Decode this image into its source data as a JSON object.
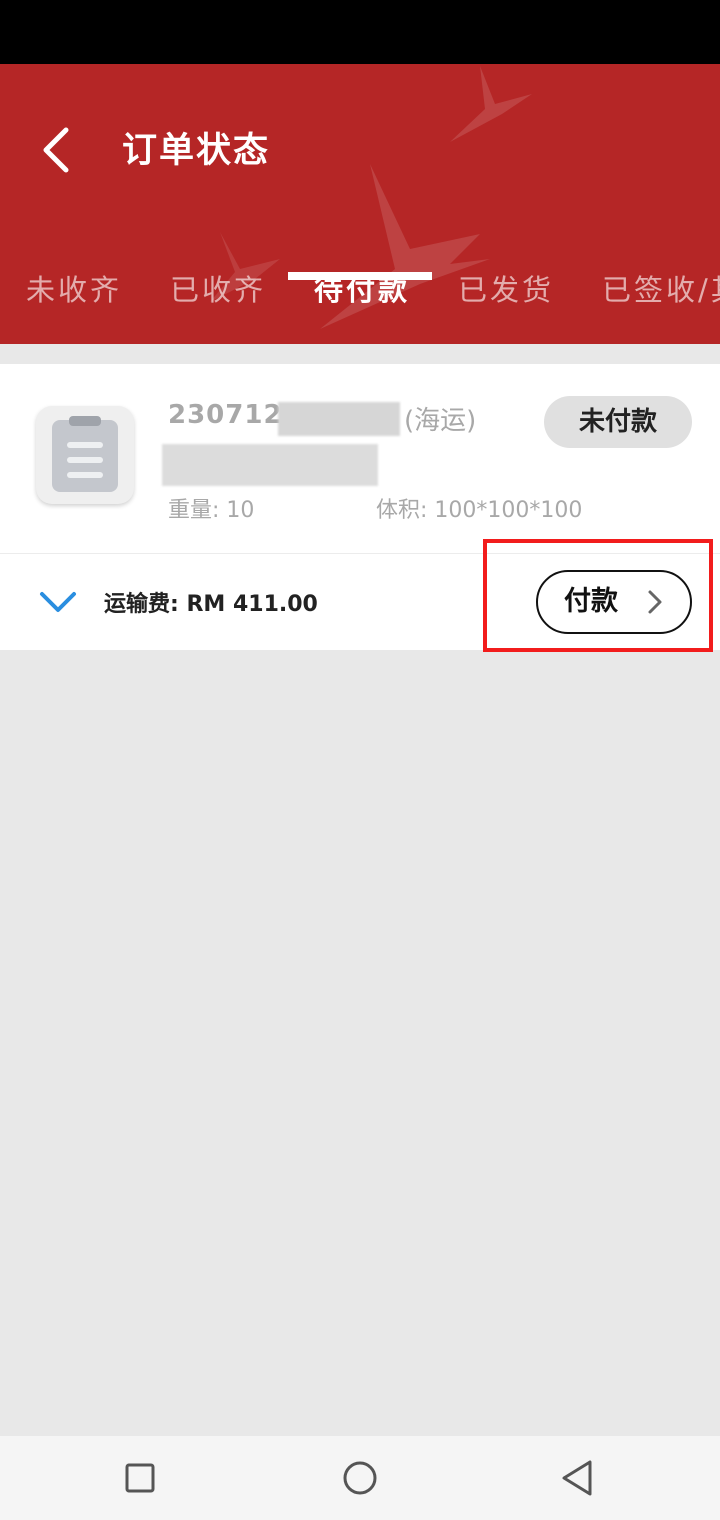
{
  "header": {
    "title": "订单状态",
    "tabs": [
      {
        "label": "未收齐"
      },
      {
        "label": "已收齐"
      },
      {
        "label": "待付款"
      },
      {
        "label": "已发货"
      },
      {
        "label": "已签收/其"
      }
    ],
    "active_tab": "待付款",
    "brand_color": "#b52626"
  },
  "order": {
    "id": "230712-",
    "shipping_mode": "(海运)",
    "status_badge": "未付款",
    "weight": "重量: 10",
    "volume": "体积: 100*100*100",
    "shipping_fee": "运输费: RM 411.00",
    "pay_button": "付款"
  },
  "annotation_color": "#f21c1c",
  "icons": {
    "back": "back-arrow-icon",
    "order": "clipboard-icon",
    "expand": "chevron-down-icon",
    "pay": "chevron-right-icon",
    "nav_recent": "square-icon",
    "nav_home": "circle-icon",
    "nav_back": "triangle-back-icon"
  }
}
